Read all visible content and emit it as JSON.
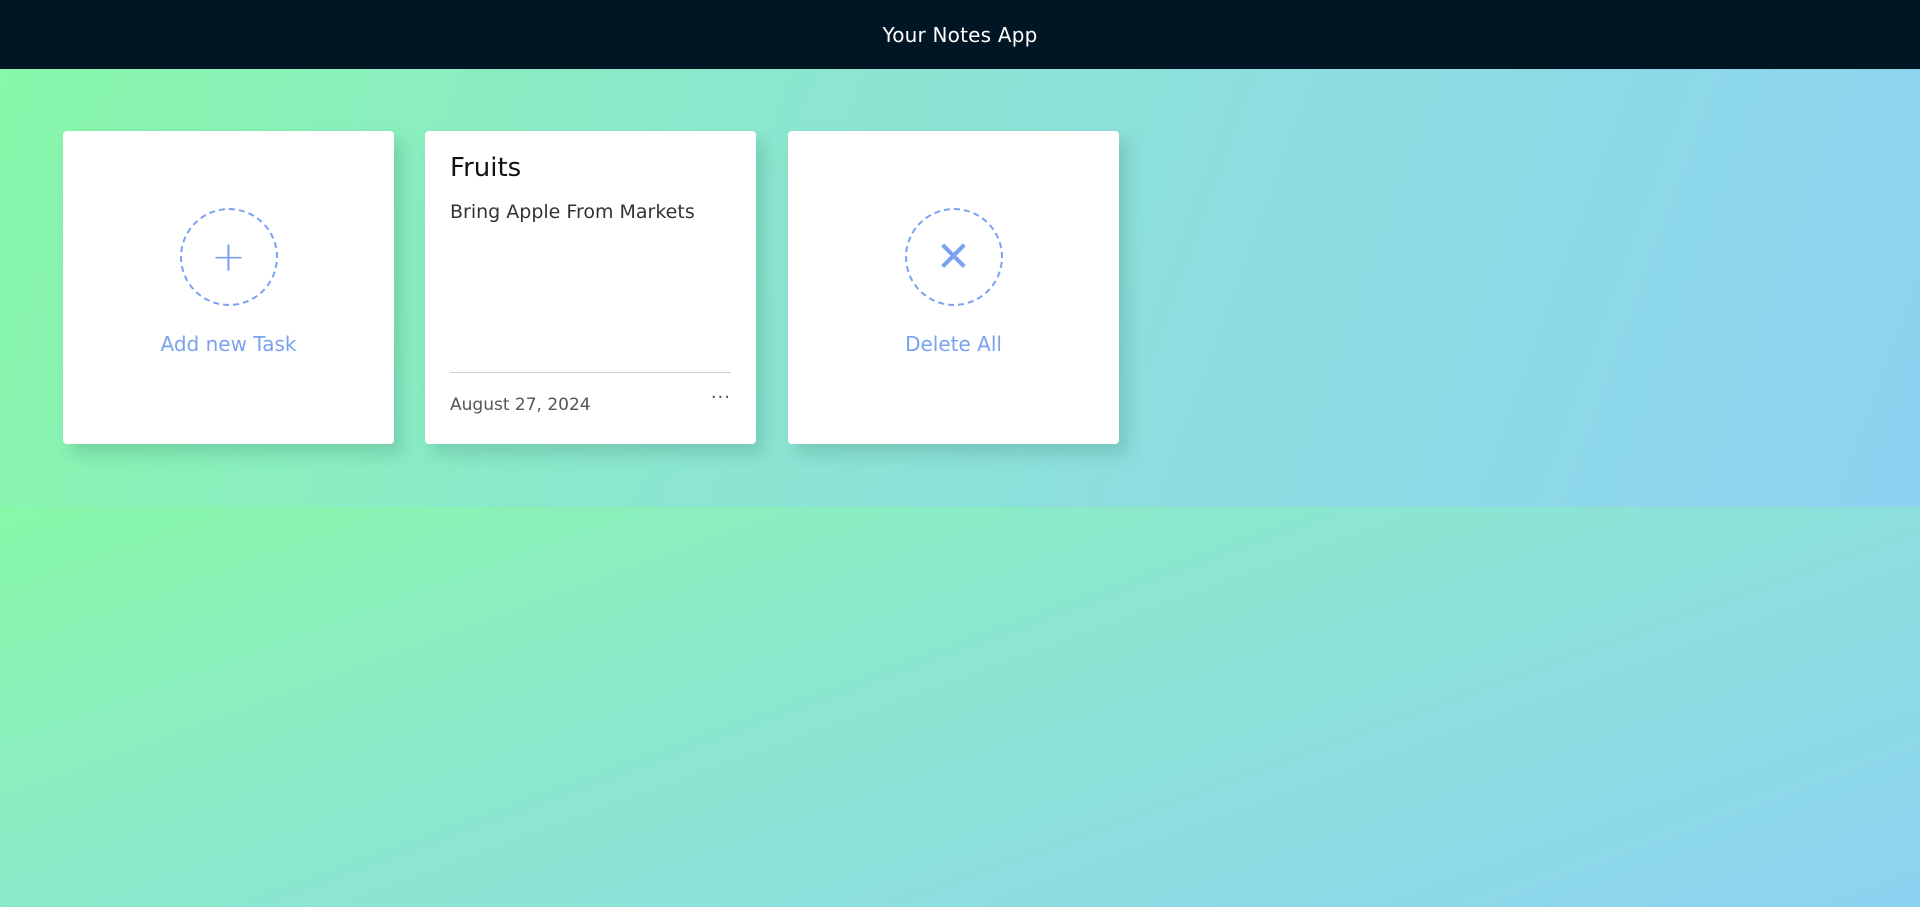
{
  "header": {
    "title": "Your Notes App"
  },
  "add_card": {
    "icon": "plus-icon",
    "icon_glyph": "+",
    "label": "Add new Task"
  },
  "note": {
    "title": "Fruits",
    "description": "Bring Apple From Markets",
    "date": "August 27, 2024",
    "menu_icon": "ellipsis-icon",
    "menu_glyph": "···"
  },
  "delete_card": {
    "icon": "close-icon",
    "icon_glyph": "✕",
    "label": "Delete All"
  },
  "colors": {
    "navbar": "#011624",
    "accent": "#7aa2f0",
    "gradient_start": "#88f8a8",
    "gradient_end": "#8dd2f2"
  }
}
